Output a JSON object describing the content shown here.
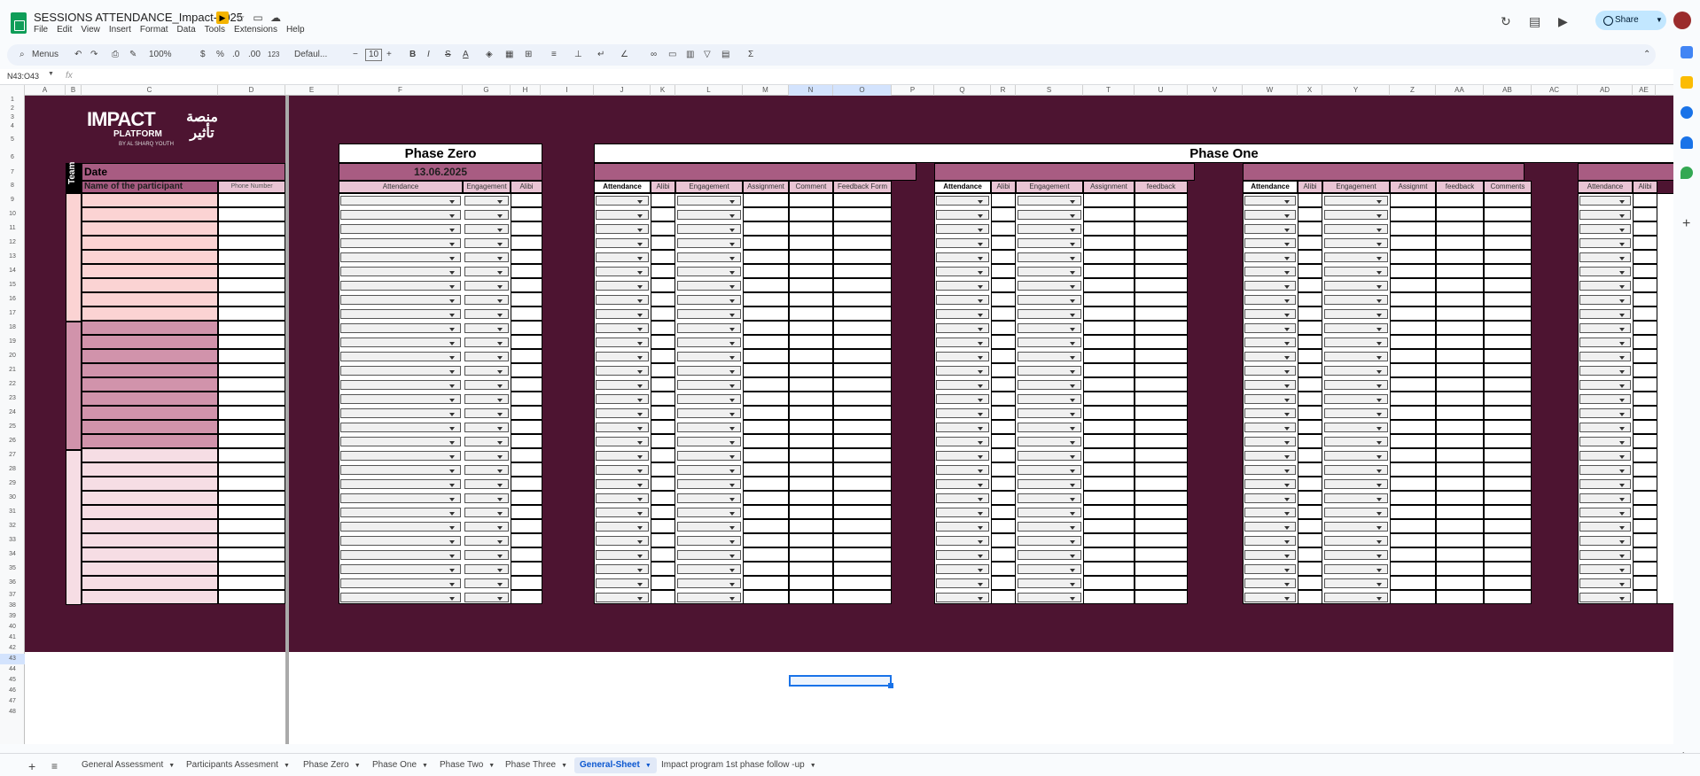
{
  "doc": {
    "title": "SESSIONS ATTENDANCE_Impact-2025"
  },
  "menu": [
    "File",
    "Edit",
    "View",
    "Insert",
    "Format",
    "Data",
    "Tools",
    "Extensions",
    "Help"
  ],
  "toolbar": {
    "menus": "Menus",
    "zoom": "100%",
    "currency": "$",
    "percent": "%",
    "decimal_dec": ".0",
    "decimal_inc": ".00",
    "number_fmt": "123",
    "font": "Defaul...",
    "font_size": "10"
  },
  "header": {
    "share": "Share"
  },
  "formula": {
    "namebox": "N43:O43",
    "fx": "fx"
  },
  "columns": [
    "A",
    "B",
    "C",
    "D",
    "E",
    "F",
    "G",
    "H",
    "I",
    "J",
    "K",
    "L",
    "M",
    "N",
    "O",
    "P",
    "Q",
    "R",
    "S",
    "T",
    "U",
    "V",
    "W",
    "X",
    "Y",
    "Z",
    "AA",
    "AB",
    "AC",
    "AD",
    "AE"
  ],
  "rows": [
    "1",
    "2",
    "3",
    "4",
    "5",
    "6",
    "7",
    "8",
    "9",
    "10",
    "11",
    "12",
    "13",
    "14",
    "15",
    "16",
    "17",
    "18",
    "19",
    "20",
    "21",
    "22",
    "23",
    "24",
    "25",
    "26",
    "27",
    "28",
    "29",
    "30",
    "31",
    "32",
    "33",
    "34",
    "35",
    "36",
    "37",
    "38",
    "39",
    "40",
    "41",
    "42",
    "43",
    "44",
    "45",
    "46",
    "47",
    "48"
  ],
  "logo": {
    "main": "IMPACT",
    "sub": "PLATFORM",
    "arabic": "منصة تأثير",
    "by": "BY AL SHARQ YOUTH"
  },
  "sheet": {
    "team": "Team",
    "date_label": "Date",
    "participant": "Name of the participant",
    "phone": "Phone Number",
    "phase_zero": "Phase Zero",
    "phase_zero_date": "13.06.2025",
    "phase_one": "Phase One",
    "pz_cols": [
      "Attendance",
      "Engagement",
      "Alibi"
    ],
    "p1a_cols": [
      "Attendance",
      "Alibi",
      "Engagement",
      "Assignment",
      "Comment",
      "Feedback Form"
    ],
    "p1b_cols": [
      "Attendance",
      "Alibi",
      "Engagement",
      "Assignment",
      "feedback"
    ],
    "p1c_cols": [
      "Attendance",
      "Alibi",
      "Engagement",
      "Assignmt",
      "feedback",
      "Comments"
    ],
    "p1d_cols": [
      "Attendance",
      "Alibi"
    ]
  },
  "tabs": [
    {
      "label": "General Assessment"
    },
    {
      "label": "Participants Assesment"
    },
    {
      "label": "Phase Zero"
    },
    {
      "label": "Phase One"
    },
    {
      "label": "Phase Two"
    },
    {
      "label": "Phase Three"
    },
    {
      "label": "General-Sheet"
    },
    {
      "label": "Impact program 1st phase follow -up"
    }
  ],
  "colors": {
    "maroon": "#4d1431",
    "pink_header": "#a85c82",
    "light_pink": "#e9c4d4",
    "accent": "#0b57d0"
  }
}
